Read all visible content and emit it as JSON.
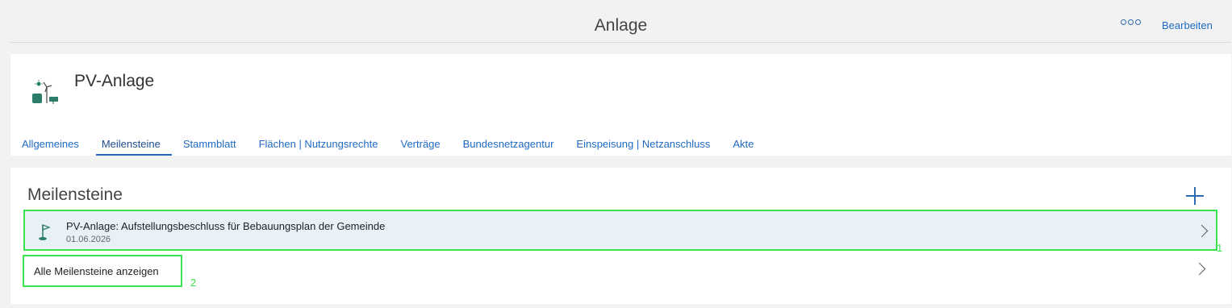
{
  "header": {
    "title": "Anlage",
    "more_icon": "ellipsis-icon",
    "edit_label": "Bearbeiten"
  },
  "entity": {
    "title": "PV-Anlage",
    "icon": "renewable-plant-icon"
  },
  "tabs": [
    {
      "label": "Allgemeines"
    },
    {
      "label": "Meilensteine",
      "active": true
    },
    {
      "label": "Stammblatt"
    },
    {
      "label": "Flächen | Nutzungsrechte"
    },
    {
      "label": "Verträge"
    },
    {
      "label": "Bundesnetzagentur"
    },
    {
      "label": "Einspeisung | Netzanschluss"
    },
    {
      "label": "Akte"
    }
  ],
  "milestones": {
    "section_title": "Meilensteine",
    "add_icon": "plus-icon",
    "items": [
      {
        "title": "PV-Anlage: Aufstellungsbeschluss für Bebauungsplan der Gemeinde",
        "date": "01.06.2026",
        "icon": "flag-icon",
        "badge": "1"
      }
    ],
    "show_all_label": "Alle Meilensteine anzeigen",
    "show_all_badge": "2"
  },
  "colors": {
    "accent": "#1f6ac2",
    "highlight_border": "#39e34f",
    "row_selected_bg": "#e8f0f8",
    "icon_green": "#2e7d6b"
  }
}
